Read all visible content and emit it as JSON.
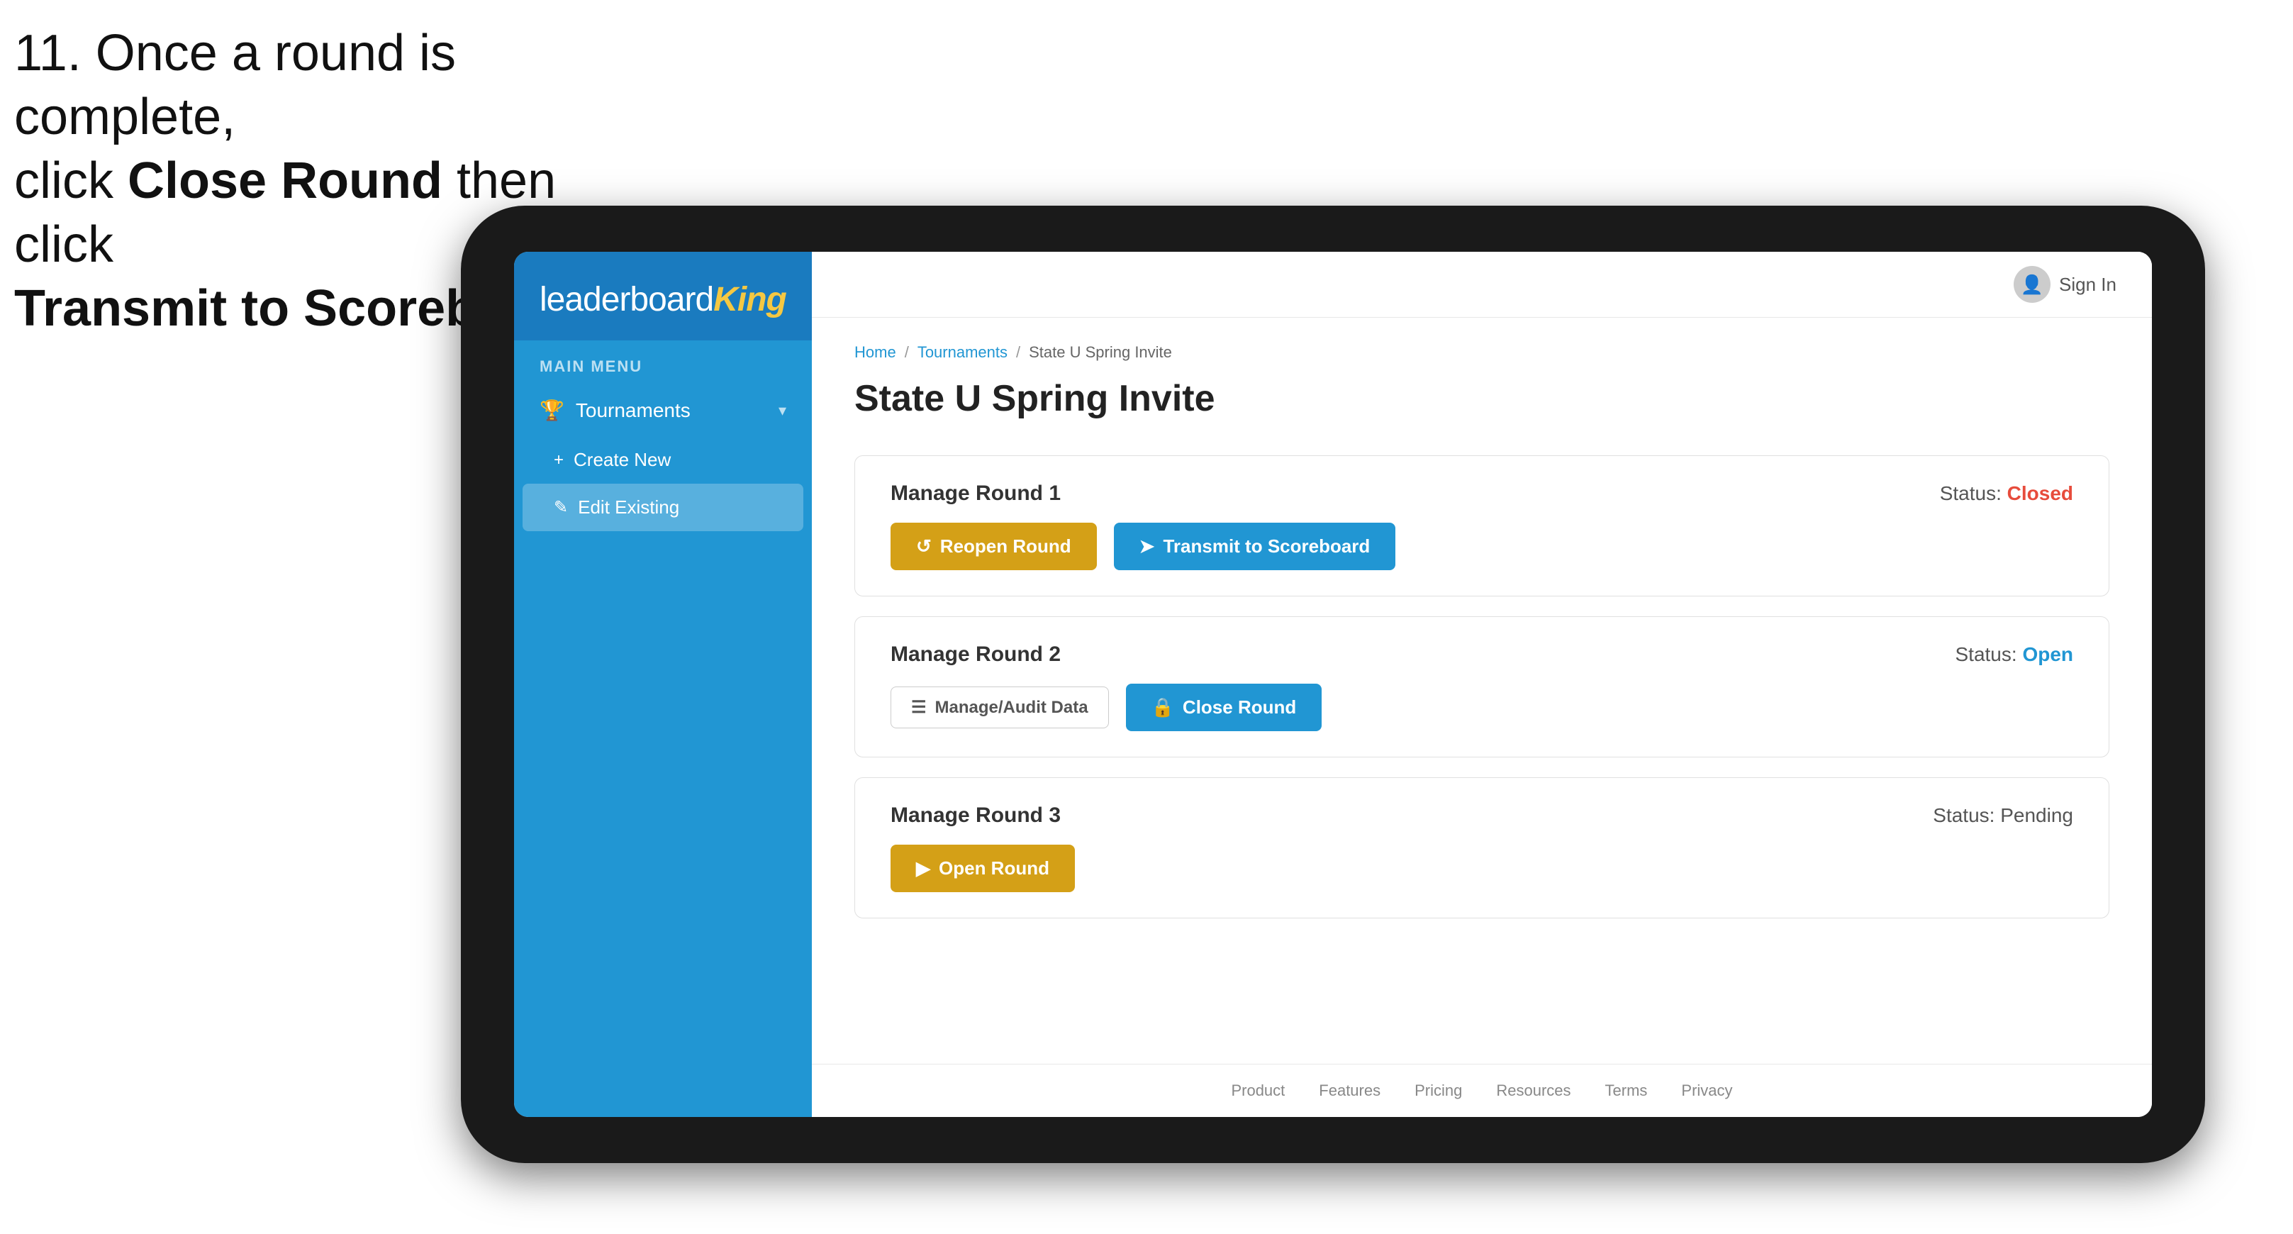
{
  "instruction": {
    "line1": "11. Once a round is complete,",
    "line2": "click ",
    "bold1": "Close Round",
    "line3": " then click",
    "bold2": "Transmit to Scoreboard."
  },
  "header": {
    "sign_in_label": "Sign In"
  },
  "breadcrumb": {
    "home": "Home",
    "separator1": "/",
    "tournaments": "Tournaments",
    "separator2": "/",
    "current": "State U Spring Invite"
  },
  "page": {
    "title": "State U Spring Invite"
  },
  "main_menu_label": "MAIN MENU",
  "sidebar": {
    "logo_text": "Leaderboard",
    "logo_bold": "King",
    "nav": [
      {
        "label": "Tournaments",
        "icon": "🏆",
        "expanded": true,
        "sub_items": [
          {
            "label": "Create New",
            "icon": "+",
            "active": false
          },
          {
            "label": "Edit Existing",
            "icon": "✎",
            "active": true
          }
        ]
      }
    ]
  },
  "rounds": [
    {
      "title": "Manage Round 1",
      "status_label": "Status:",
      "status_value": "Closed",
      "status_class": "status-closed",
      "actions": [
        {
          "label": "Reopen Round",
          "style": "btn-amber",
          "icon": "↺"
        },
        {
          "label": "Transmit to Scoreboard",
          "style": "btn-blue",
          "icon": "➤"
        }
      ]
    },
    {
      "title": "Manage Round 2",
      "status_label": "Status:",
      "status_value": "Open",
      "status_class": "status-open",
      "actions": [
        {
          "label": "Manage/Audit Data",
          "style": "btn-outline",
          "icon": "☰"
        },
        {
          "label": "Close Round",
          "style": "btn-blue",
          "icon": "🔒"
        }
      ]
    },
    {
      "title": "Manage Round 3",
      "status_label": "Status:",
      "status_value": "Pending",
      "status_class": "status-pending",
      "actions": [
        {
          "label": "Open Round",
          "style": "btn-amber",
          "icon": "▶"
        }
      ]
    }
  ],
  "footer": {
    "links": [
      "Product",
      "Features",
      "Pricing",
      "Resources",
      "Terms",
      "Privacy"
    ]
  }
}
